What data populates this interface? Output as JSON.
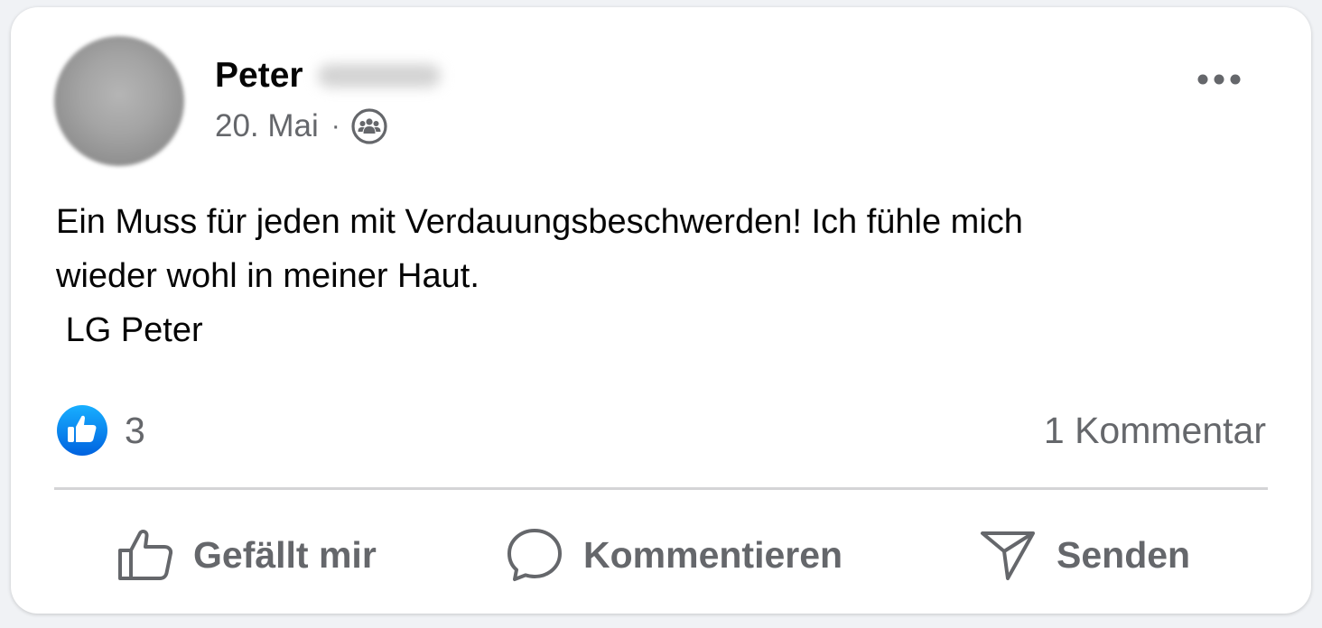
{
  "post": {
    "author_first_name": "Peter",
    "date": "20. Mai",
    "separator": "·",
    "audience_icon": "group-icon",
    "text": "Ein Muss für jeden mit Verdauungsbeschwerden! Ich fühle mich\nwieder wohl in meiner Haut.\n LG Peter"
  },
  "stats": {
    "like_count": "3",
    "comments": "1 Kommentar"
  },
  "actions": {
    "like_label": "Gefällt mir",
    "comment_label": "Kommentieren",
    "send_label": "Senden"
  },
  "colors": {
    "like_blue": "#1877f2",
    "secondary_text": "#65676b",
    "primary_text": "#050505"
  }
}
